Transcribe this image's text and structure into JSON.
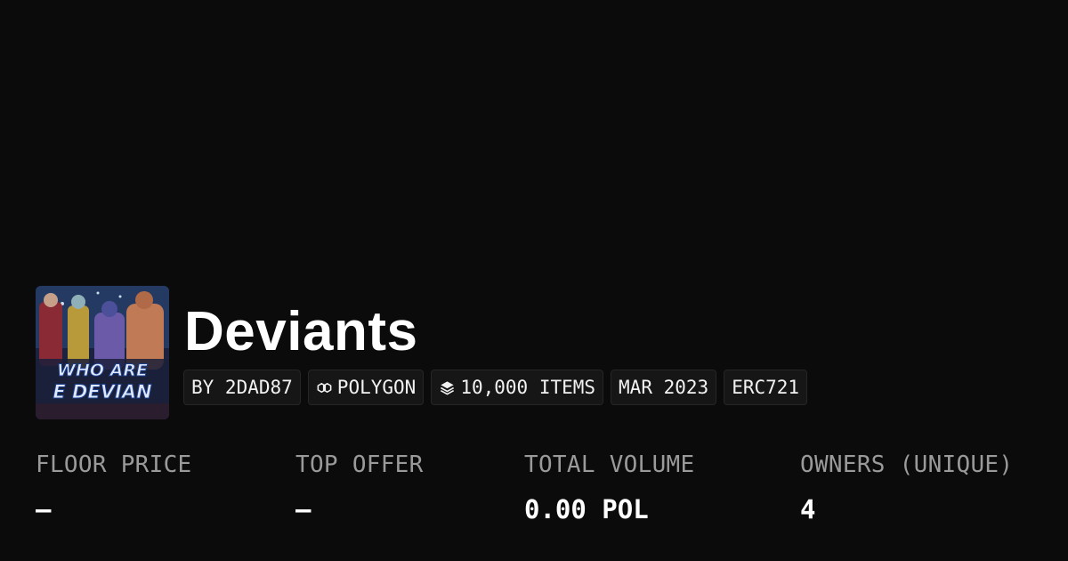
{
  "collection": {
    "title": "Deviants",
    "thumbnail_text": [
      "WHO ARE",
      "E DEVIAN"
    ],
    "chips": [
      {
        "icon": "none",
        "label": "BY 2DAD87"
      },
      {
        "icon": "polygon-chain-icon",
        "label": "POLYGON"
      },
      {
        "icon": "layers-icon",
        "label": "10,000 ITEMS"
      },
      {
        "icon": "none",
        "label": "MAR 2023"
      },
      {
        "icon": "none",
        "label": "ERC721"
      }
    ]
  },
  "stats": [
    {
      "label": "FLOOR PRICE",
      "value": "–"
    },
    {
      "label": "TOP OFFER",
      "value": "–"
    },
    {
      "label": "TOTAL VOLUME",
      "value": "0.00 POL"
    },
    {
      "label": "OWNERS (UNIQUE)",
      "value": "4"
    }
  ],
  "colors": {
    "background": "#0b0b0b",
    "chip_bg": "#161616",
    "label": "#9a9a9a"
  }
}
